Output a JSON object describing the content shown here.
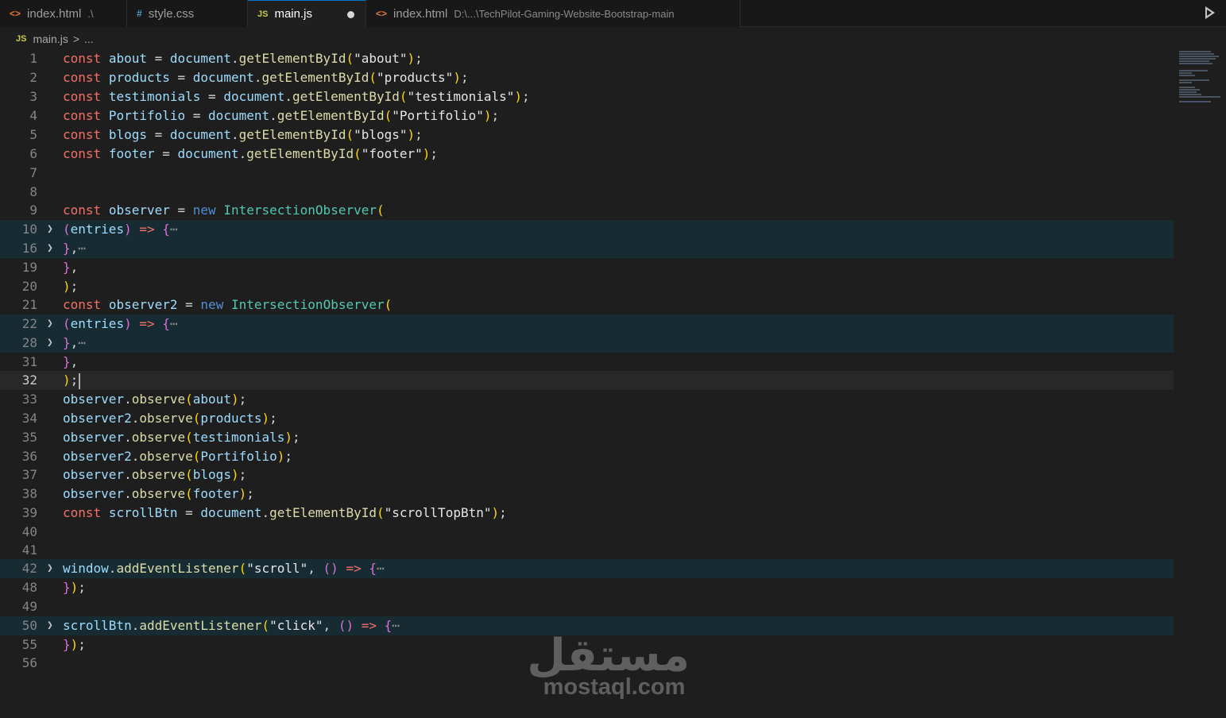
{
  "tabs": [
    {
      "icon": "<>",
      "label": "index.html",
      "desc": ".\\"
    },
    {
      "icon": "#",
      "label": "style.css",
      "desc": ""
    },
    {
      "icon": "JS",
      "label": "main.js",
      "desc": ""
    },
    {
      "icon": "<>",
      "label": "index.html",
      "desc": "D:\\...\\TechPilot-Gaming-Website-Bootstrap-main"
    }
  ],
  "breadcrumb": {
    "icon": "JS",
    "file": "main.js",
    "sep": ">",
    "more": "..."
  },
  "lines": {
    "l1": "1",
    "l2": "2",
    "l3": "3",
    "l4": "4",
    "l5": "5",
    "l6": "6",
    "l7": "7",
    "l8": "8",
    "l9": "9",
    "l10": "10",
    "l16": "16",
    "l19": "19",
    "l20": "20",
    "l21": "21",
    "l22": "22",
    "l28": "28",
    "l31": "31",
    "l32": "32",
    "l33": "33",
    "l34": "34",
    "l35": "35",
    "l36": "36",
    "l37": "37",
    "l38": "38",
    "l39": "39",
    "l40": "40",
    "l41": "41",
    "l42": "42",
    "l48": "48",
    "l49": "49",
    "l50": "50",
    "l55": "55",
    "l56": "56"
  },
  "tok": {
    "const": "const",
    "new": "new",
    "eq": " = ",
    "dot": ".",
    "semi": ";",
    "comma": ",",
    "about": "about",
    "products": "products",
    "testimonials": "testimonials",
    "Portifolio": "Portifolio",
    "blogs": "blogs",
    "footer": "footer",
    "document": "document",
    "getElementById": "getElementById",
    "s_about": "\"about\"",
    "s_products": "\"products\"",
    "s_testimonials": "\"testimonials\"",
    "s_Portifolio": "\"Portifolio\"",
    "s_blogs": "\"blogs\"",
    "s_footer": "\"footer\"",
    "observer": "observer",
    "observer2": "observer2",
    "IntersectionObserver": "IntersectionObserver",
    "entries": "entries",
    "arrow": "=>",
    "ellipsis": "⋯",
    "observe": "observe",
    "scrollBtn": "scrollBtn",
    "s_scrollTopBtn": "\"scrollTopBtn\"",
    "window": "window",
    "addEventListener": "addEventListener",
    "s_scroll": "\"scroll\"",
    "s_click": "\"click\"",
    "lp": "(",
    "rp": ")",
    "lb": "{",
    "rb": "}",
    "empty": "()"
  },
  "watermark": {
    "arabic": "مستقل",
    "latin": "mostaql.com"
  }
}
